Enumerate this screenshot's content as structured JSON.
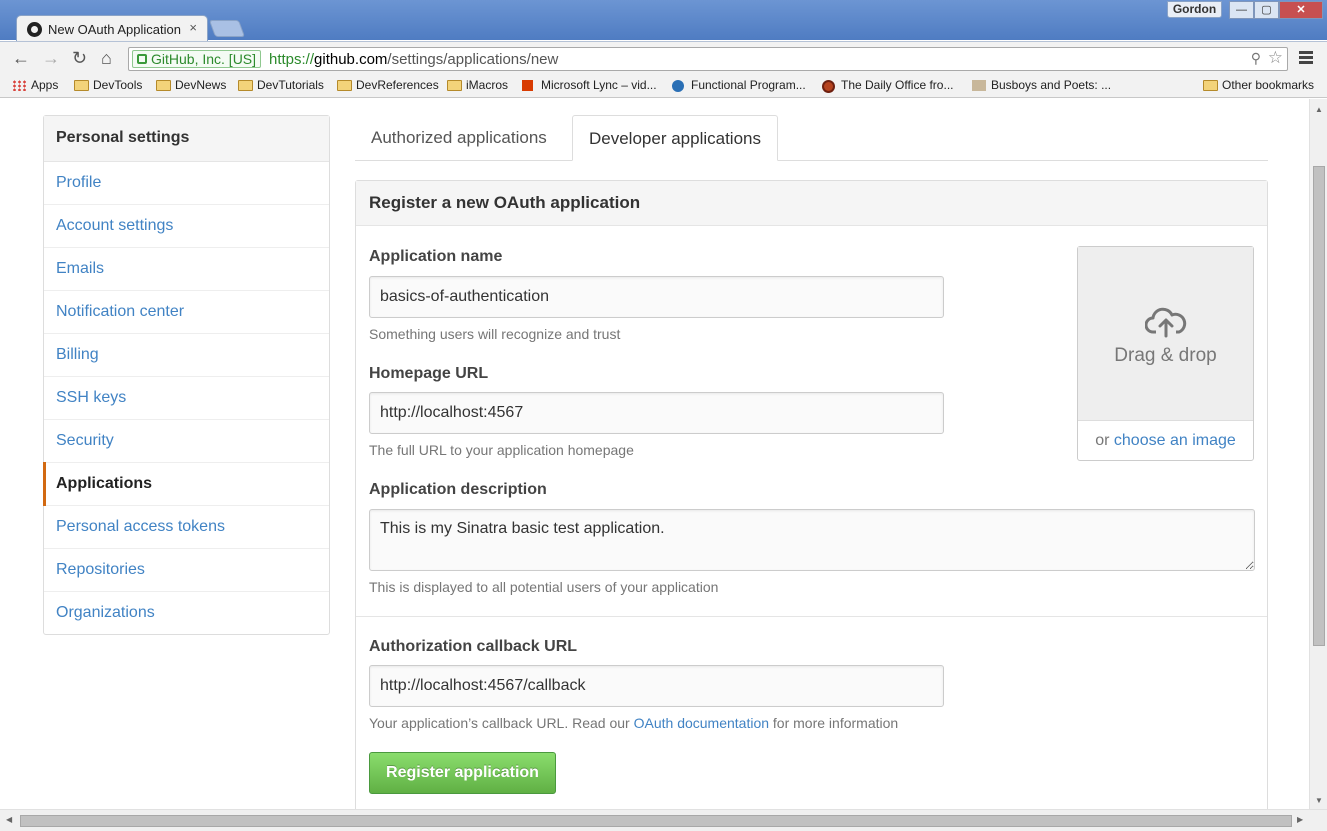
{
  "browser": {
    "tab_title": "New OAuth Application",
    "tab_close": "×",
    "user": "Gordon",
    "window_min": "—",
    "window_max": "▢",
    "window_close": "✕",
    "ev_label": "GitHub, Inc. [US]",
    "url_scheme": "https://",
    "url_host": "github.com",
    "url_path": "/settings/applications/new",
    "bookmarks": [
      {
        "label": "Apps"
      },
      {
        "label": "DevTools"
      },
      {
        "label": "DevNews"
      },
      {
        "label": "DevTutorials"
      },
      {
        "label": "DevReferences"
      },
      {
        "label": "iMacros"
      },
      {
        "label": "Microsoft Lync – vid..."
      },
      {
        "label": "Functional Program..."
      },
      {
        "label": "The Daily Office fro..."
      },
      {
        "label": "Busboys and Poets: ..."
      },
      {
        "label": "Other bookmarks"
      }
    ]
  },
  "sidebar": {
    "heading": "Personal settings",
    "items": [
      {
        "label": "Profile"
      },
      {
        "label": "Account settings"
      },
      {
        "label": "Emails"
      },
      {
        "label": "Notification center"
      },
      {
        "label": "Billing"
      },
      {
        "label": "SSH keys"
      },
      {
        "label": "Security"
      },
      {
        "label": "Applications",
        "active": true
      },
      {
        "label": "Personal access tokens"
      },
      {
        "label": "Repositories"
      },
      {
        "label": "Organizations"
      }
    ]
  },
  "tabs": [
    {
      "label": "Authorized applications"
    },
    {
      "label": "Developer applications",
      "selected": true
    }
  ],
  "form": {
    "heading": "Register a new OAuth application",
    "app_name_label": "Application name",
    "app_name_value": "basics-of-authentication",
    "app_name_hint": "Something users will recognize and trust",
    "homepage_label": "Homepage URL",
    "homepage_value": "http://localhost:4567",
    "homepage_hint": "The full URL to your application homepage",
    "description_label": "Application description",
    "description_value": "This is my Sinatra basic test application.",
    "description_hint": "This is displayed to all potential users of your application",
    "callback_label": "Authorization callback URL",
    "callback_value": "http://localhost:4567/callback",
    "callback_hint_before": "Your application’s callback URL. Read our ",
    "callback_hint_link": "OAuth documentation",
    "callback_hint_after": " for more information",
    "submit_label": "Register application",
    "dropzone_text": "Drag & drop",
    "dropzone_or": "or ",
    "dropzone_link": "choose an image"
  },
  "colors": {
    "link": "#4183c4",
    "active_accent": "#d26911",
    "button_green": "#60b044"
  }
}
